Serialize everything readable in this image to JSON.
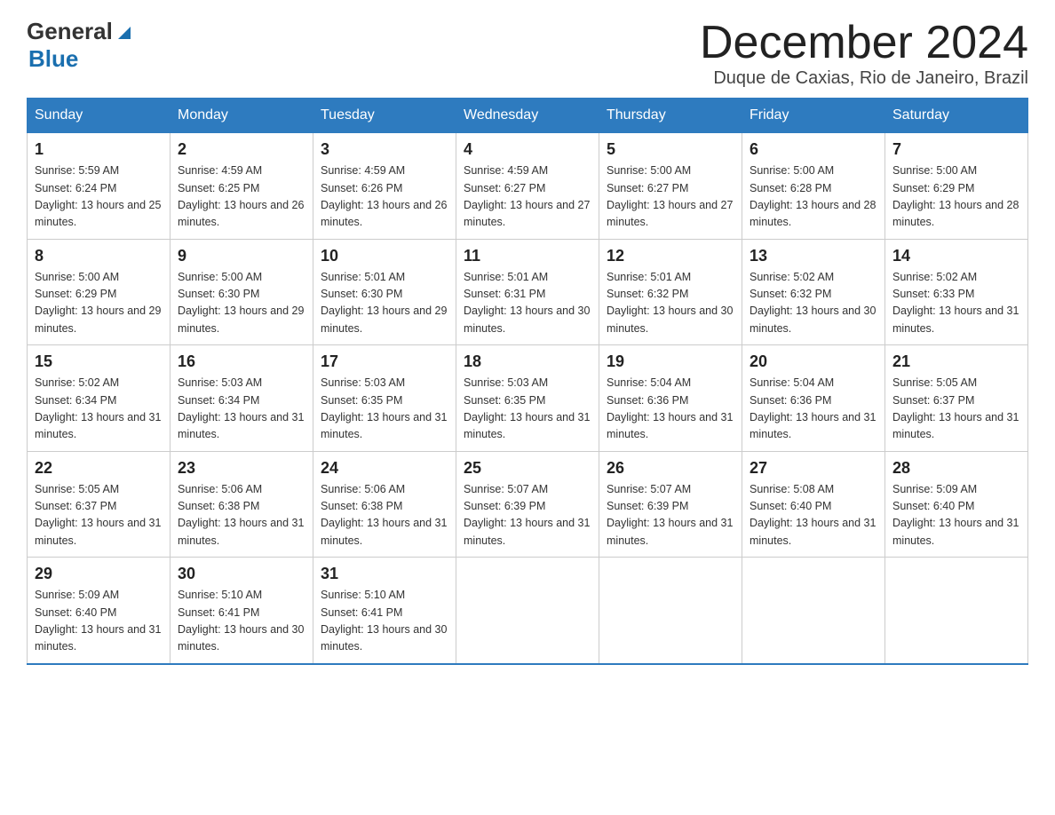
{
  "logo": {
    "general": "General",
    "blue": "Blue"
  },
  "title": "December 2024",
  "location": "Duque de Caxias, Rio de Janeiro, Brazil",
  "weekdays": [
    "Sunday",
    "Monday",
    "Tuesday",
    "Wednesday",
    "Thursday",
    "Friday",
    "Saturday"
  ],
  "weeks": [
    [
      {
        "day": "1",
        "sunrise": "5:59 AM",
        "sunset": "6:24 PM",
        "daylight": "13 hours and 25 minutes."
      },
      {
        "day": "2",
        "sunrise": "4:59 AM",
        "sunset": "6:25 PM",
        "daylight": "13 hours and 26 minutes."
      },
      {
        "day": "3",
        "sunrise": "4:59 AM",
        "sunset": "6:26 PM",
        "daylight": "13 hours and 26 minutes."
      },
      {
        "day": "4",
        "sunrise": "4:59 AM",
        "sunset": "6:27 PM",
        "daylight": "13 hours and 27 minutes."
      },
      {
        "day": "5",
        "sunrise": "5:00 AM",
        "sunset": "6:27 PM",
        "daylight": "13 hours and 27 minutes."
      },
      {
        "day": "6",
        "sunrise": "5:00 AM",
        "sunset": "6:28 PM",
        "daylight": "13 hours and 28 minutes."
      },
      {
        "day": "7",
        "sunrise": "5:00 AM",
        "sunset": "6:29 PM",
        "daylight": "13 hours and 28 minutes."
      }
    ],
    [
      {
        "day": "8",
        "sunrise": "5:00 AM",
        "sunset": "6:29 PM",
        "daylight": "13 hours and 29 minutes."
      },
      {
        "day": "9",
        "sunrise": "5:00 AM",
        "sunset": "6:30 PM",
        "daylight": "13 hours and 29 minutes."
      },
      {
        "day": "10",
        "sunrise": "5:01 AM",
        "sunset": "6:30 PM",
        "daylight": "13 hours and 29 minutes."
      },
      {
        "day": "11",
        "sunrise": "5:01 AM",
        "sunset": "6:31 PM",
        "daylight": "13 hours and 30 minutes."
      },
      {
        "day": "12",
        "sunrise": "5:01 AM",
        "sunset": "6:32 PM",
        "daylight": "13 hours and 30 minutes."
      },
      {
        "day": "13",
        "sunrise": "5:02 AM",
        "sunset": "6:32 PM",
        "daylight": "13 hours and 30 minutes."
      },
      {
        "day": "14",
        "sunrise": "5:02 AM",
        "sunset": "6:33 PM",
        "daylight": "13 hours and 31 minutes."
      }
    ],
    [
      {
        "day": "15",
        "sunrise": "5:02 AM",
        "sunset": "6:34 PM",
        "daylight": "13 hours and 31 minutes."
      },
      {
        "day": "16",
        "sunrise": "5:03 AM",
        "sunset": "6:34 PM",
        "daylight": "13 hours and 31 minutes."
      },
      {
        "day": "17",
        "sunrise": "5:03 AM",
        "sunset": "6:35 PM",
        "daylight": "13 hours and 31 minutes."
      },
      {
        "day": "18",
        "sunrise": "5:03 AM",
        "sunset": "6:35 PM",
        "daylight": "13 hours and 31 minutes."
      },
      {
        "day": "19",
        "sunrise": "5:04 AM",
        "sunset": "6:36 PM",
        "daylight": "13 hours and 31 minutes."
      },
      {
        "day": "20",
        "sunrise": "5:04 AM",
        "sunset": "6:36 PM",
        "daylight": "13 hours and 31 minutes."
      },
      {
        "day": "21",
        "sunrise": "5:05 AM",
        "sunset": "6:37 PM",
        "daylight": "13 hours and 31 minutes."
      }
    ],
    [
      {
        "day": "22",
        "sunrise": "5:05 AM",
        "sunset": "6:37 PM",
        "daylight": "13 hours and 31 minutes."
      },
      {
        "day": "23",
        "sunrise": "5:06 AM",
        "sunset": "6:38 PM",
        "daylight": "13 hours and 31 minutes."
      },
      {
        "day": "24",
        "sunrise": "5:06 AM",
        "sunset": "6:38 PM",
        "daylight": "13 hours and 31 minutes."
      },
      {
        "day": "25",
        "sunrise": "5:07 AM",
        "sunset": "6:39 PM",
        "daylight": "13 hours and 31 minutes."
      },
      {
        "day": "26",
        "sunrise": "5:07 AM",
        "sunset": "6:39 PM",
        "daylight": "13 hours and 31 minutes."
      },
      {
        "day": "27",
        "sunrise": "5:08 AM",
        "sunset": "6:40 PM",
        "daylight": "13 hours and 31 minutes."
      },
      {
        "day": "28",
        "sunrise": "5:09 AM",
        "sunset": "6:40 PM",
        "daylight": "13 hours and 31 minutes."
      }
    ],
    [
      {
        "day": "29",
        "sunrise": "5:09 AM",
        "sunset": "6:40 PM",
        "daylight": "13 hours and 31 minutes."
      },
      {
        "day": "30",
        "sunrise": "5:10 AM",
        "sunset": "6:41 PM",
        "daylight": "13 hours and 30 minutes."
      },
      {
        "day": "31",
        "sunrise": "5:10 AM",
        "sunset": "6:41 PM",
        "daylight": "13 hours and 30 minutes."
      },
      null,
      null,
      null,
      null
    ]
  ]
}
